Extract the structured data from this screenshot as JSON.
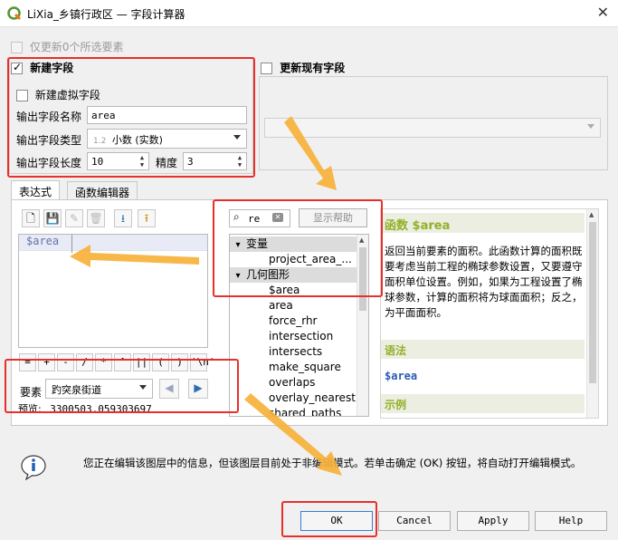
{
  "window": {
    "title": "LiXia_乡镇行政区 — 字段计算器",
    "close_icon": "✕"
  },
  "update_selected": {
    "label": "仅更新0个所选要素"
  },
  "new_field": {
    "label": "新建字段",
    "virtual_label": "新建虚拟字段",
    "name_label": "输出字段名称",
    "name_value": "area",
    "type_label": "输出字段类型",
    "type_badge": "1.2",
    "type_value": "小数 (实数)",
    "length_label": "输出字段长度",
    "length_value": "10",
    "precision_label": "精度",
    "precision_value": "3"
  },
  "update_existing": {
    "label": "更新现有字段"
  },
  "tabs": {
    "expression": "表达式",
    "function_editor": "函数编辑器"
  },
  "expression": {
    "text": "$area"
  },
  "operators": [
    "=",
    "+",
    "-",
    "/",
    "*",
    "^",
    "||",
    "(",
    ")",
    "'\\n'"
  ],
  "feature": {
    "label": "要素",
    "value": "趵突泉街道",
    "preview_label": "预览:",
    "preview_value": "3300503.059303697"
  },
  "search": {
    "value": "re",
    "show_help": "显示帮助"
  },
  "tree": {
    "groups": [
      {
        "name": "变量",
        "items": [
          "project_area_..."
        ]
      },
      {
        "name": "几何图形",
        "items": [
          "$area",
          "area",
          "force_rhr",
          "intersection",
          "intersects",
          "make_square",
          "overlaps",
          "overlay_nearest",
          "shared_paths"
        ]
      }
    ]
  },
  "help": {
    "title": "函数 $area",
    "description": "返回当前要素的面积。此函数计算的面积既要考虑当前工程的椭球参数设置，又要遵守面积单位设置。例如，如果为工程设置了椭球参数，计算的面积将为球面面积；反之，为平面面积。",
    "syntax_label": "语法",
    "syntax": "$area",
    "examples_label": "示例"
  },
  "info": {
    "text": "您正在编辑该图层中的信息，但该图层目前处于非编辑模式。若单击确定 (OK) 按钮，将自动打开编辑模式。"
  },
  "buttons": {
    "ok": "OK",
    "cancel": "Cancel",
    "apply": "Apply",
    "help": "Help"
  },
  "colors": {
    "highlight": "#e8302a",
    "arrow": "#f6b23a",
    "help_heading": "#93b028",
    "expression_text": "#6272a8"
  }
}
